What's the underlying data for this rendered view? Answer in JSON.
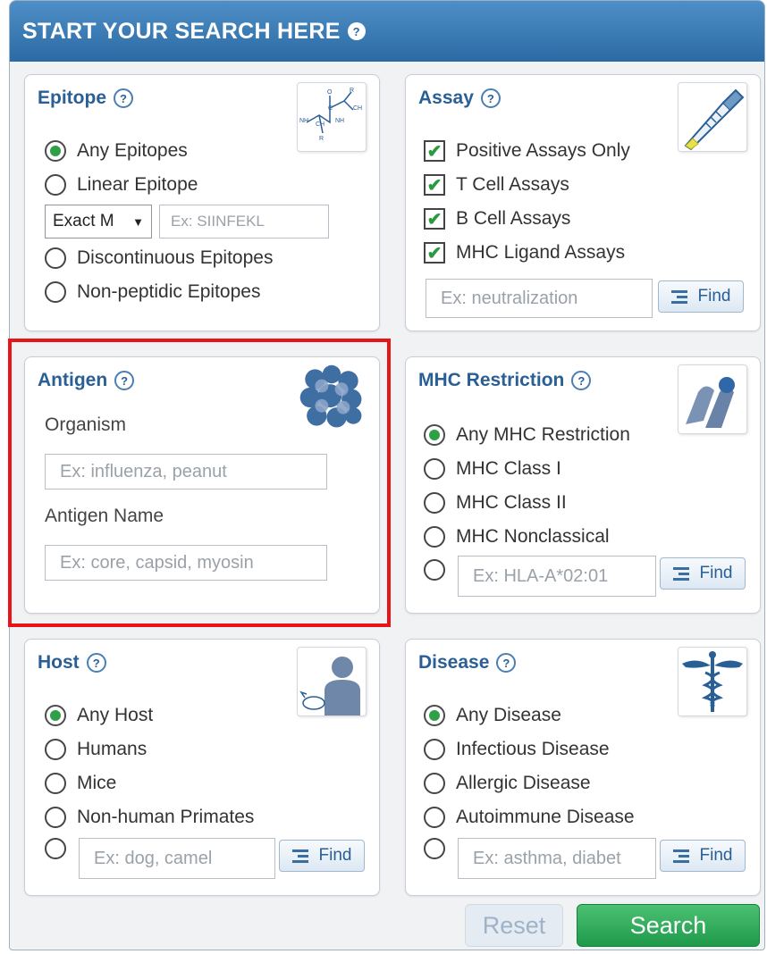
{
  "header": {
    "title": "START YOUR SEARCH HERE",
    "help": "?"
  },
  "epitope": {
    "title": "Epitope",
    "help": "?",
    "options": [
      "Any Epitopes",
      "Linear Epitope",
      "Discontinuous Epitopes",
      "Non-peptidic Epitopes"
    ],
    "selected": "Any Epitopes",
    "match_select": "Exact M",
    "sequence_placeholder": "Ex: SIINFEKL"
  },
  "assay": {
    "title": "Assay",
    "help": "?",
    "checks": [
      "Positive Assays Only",
      "T Cell Assays",
      "B Cell Assays",
      "MHC Ligand Assays"
    ],
    "search_placeholder": "Ex: neutralization",
    "find_label": "Find"
  },
  "antigen": {
    "title": "Antigen",
    "help": "?",
    "organism_label": "Organism",
    "organism_placeholder": "Ex: influenza, peanut",
    "name_label": "Antigen Name",
    "name_placeholder": "Ex: core, capsid, myosin"
  },
  "mhc": {
    "title": "MHC Restriction",
    "help": "?",
    "options": [
      "Any MHC Restriction",
      "MHC Class I",
      "MHC Class II",
      "MHC Nonclassical"
    ],
    "selected": "Any MHC Restriction",
    "search_placeholder": "Ex: HLA-A*02:01",
    "find_label": "Find"
  },
  "host": {
    "title": "Host",
    "help": "?",
    "options": [
      "Any Host",
      "Humans",
      "Mice",
      "Non-human Primates"
    ],
    "selected": "Any Host",
    "search_placeholder": "Ex: dog, camel",
    "find_label": "Find"
  },
  "disease": {
    "title": "Disease",
    "help": "?",
    "options": [
      "Any Disease",
      "Infectious Disease",
      "Allergic Disease",
      "Autoimmune Disease"
    ],
    "selected": "Any Disease",
    "search_placeholder": "Ex: asthma, diabet",
    "find_label": "Find"
  },
  "actions": {
    "reset_label": "Reset",
    "search_label": "Search"
  },
  "colors": {
    "header": "#2b6aa4",
    "title": "#2a5f96",
    "radio_on": "#2fa048",
    "search_btn": "#1f9a4b",
    "highlight": "#e8141a"
  },
  "icons": {
    "epitope": "peptide-structure-icon",
    "assay": "pipette-icon",
    "antigen": "protein-molecule-icon",
    "mhc": "mhc-molecule-icon",
    "host": "host-person-animal-icon",
    "disease": "caduceus-icon"
  }
}
